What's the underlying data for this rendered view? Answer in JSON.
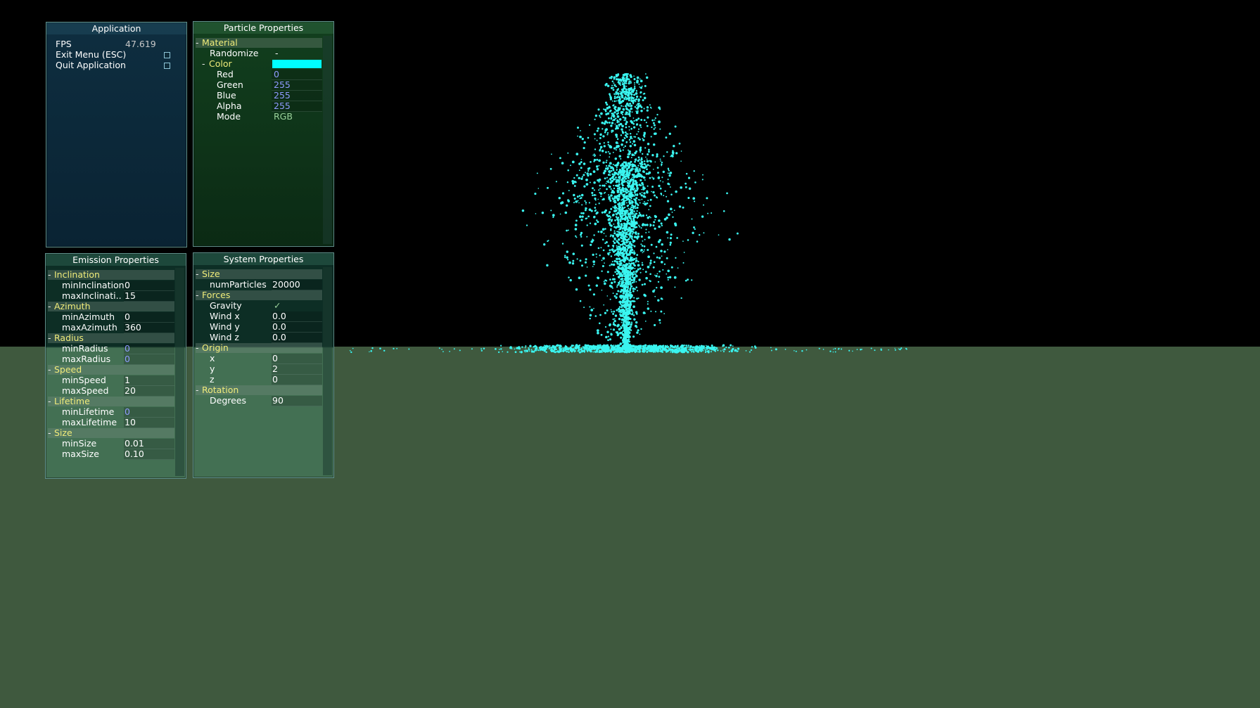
{
  "colors": {
    "ground": "#3f593e",
    "sky": "#000000",
    "particle": "#3af5f0",
    "category": "#f0ec7a",
    "value_blue": "#8f9bff"
  },
  "application": {
    "title": "Application",
    "fps_label": "FPS",
    "fps_value": "47.619",
    "exit_label": "Exit Menu (ESC)",
    "quit_label": "Quit Application"
  },
  "particle": {
    "title": "Particle Properties",
    "material_label": "Material",
    "randomize_label": "Randomize",
    "randomize_value": "-",
    "color_label": "Color",
    "swatch_color": "#00ffff",
    "red_label": "Red",
    "red_value": "0",
    "green_label": "Green",
    "green_value": "255",
    "blue_label": "Blue",
    "blue_value": "255",
    "alpha_label": "Alpha",
    "alpha_value": "255",
    "mode_label": "Mode",
    "mode_value": "RGB"
  },
  "emission": {
    "title": "Emission Properties",
    "inclination_label": "Inclination",
    "min_inclination_label": "minInclination",
    "min_inclination_value": "0",
    "max_inclination_label": "maxInclinati..",
    "max_inclination_value": "15",
    "azimuth_label": "Azimuth",
    "min_azimuth_label": "minAzimuth",
    "min_azimuth_value": "0",
    "max_azimuth_label": "maxAzimuth",
    "max_azimuth_value": "360",
    "radius_label": "Radius",
    "min_radius_label": "minRadius",
    "min_radius_value": "0",
    "max_radius_label": "maxRadius",
    "max_radius_value": "0",
    "speed_label": "Speed",
    "min_speed_label": "minSpeed",
    "min_speed_value": "1",
    "max_speed_label": "maxSpeed",
    "max_speed_value": "20",
    "lifetime_label": "Lifetime",
    "min_lifetime_label": "minLifetime",
    "min_lifetime_value": "0",
    "max_lifetime_label": "maxLifetime",
    "max_lifetime_value": "10",
    "size_label": "Size",
    "min_size_label": "minSize",
    "min_size_value": "0.01",
    "max_size_label": "maxSize",
    "max_size_value": "0.10"
  },
  "system": {
    "title": "System Properties",
    "size_label": "Size",
    "num_particles_label": "numParticles",
    "num_particles_value": "20000",
    "forces_label": "Forces",
    "gravity_label": "Gravity",
    "gravity_value": "✓",
    "wind_x_label": "Wind x",
    "wind_x_value": "0.0",
    "wind_y_label": "Wind y",
    "wind_y_value": "0.0",
    "wind_z_label": "Wind z",
    "wind_z_value": "0.0",
    "origin_label": "Origin",
    "x_label": "x",
    "x_value": "0",
    "y_label": "y",
    "y_value": "2",
    "z_label": "z",
    "z_value": "0",
    "rotation_label": "Rotation",
    "degrees_label": "Degrees",
    "degrees_value": "90"
  }
}
